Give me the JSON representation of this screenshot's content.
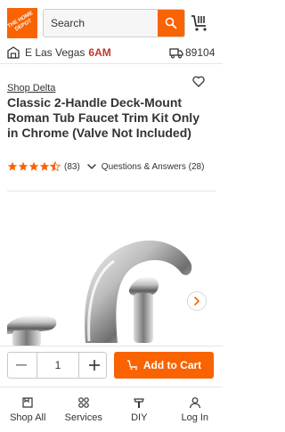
{
  "header": {
    "logo_text": "THE HOME DEPOT",
    "search_placeholder": "Search",
    "search_icon": "search-icon",
    "cart_icon": "cart-icon",
    "brand_color": "#f96302"
  },
  "location": {
    "store_name": "E Las Vegas",
    "store_hours": "6AM",
    "zip": "89104"
  },
  "product": {
    "shop_brand": "Shop Delta",
    "title": "Classic 2-Handle Deck-Mount Roman Tub Faucet Trim Kit Only in Chrome (Valve Not Included)",
    "rating": 4.5,
    "review_count": "(83)",
    "qa_label": "Questions & Answers (28)"
  },
  "cart": {
    "quantity": "1",
    "add_to_cart_label": "Add to Cart"
  },
  "bottom_nav": {
    "items": [
      {
        "label": "Shop All",
        "icon": "shop-all-icon"
      },
      {
        "label": "Services",
        "icon": "services-icon"
      },
      {
        "label": "DIY",
        "icon": "diy-icon"
      },
      {
        "label": "Log In",
        "icon": "user-icon"
      }
    ]
  }
}
